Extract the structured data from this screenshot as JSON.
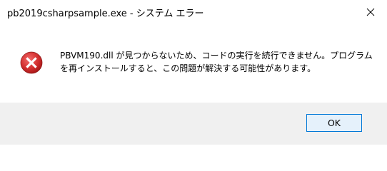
{
  "window": {
    "title": "pb2019csharpsample.exe - システム エラー"
  },
  "dialog": {
    "icon": "error-icon",
    "message": "PBVM190.dll が見つからないため、コードの実行を続行できません。プログラム\nを再インストールすると、この問題が解決する可能性があります。",
    "ok_label": "OK"
  },
  "colors": {
    "error_red": "#d32f2f",
    "footer_bg": "#f0f0f0",
    "button_border": "#0078d7",
    "button_bg": "#e5f1fb"
  }
}
